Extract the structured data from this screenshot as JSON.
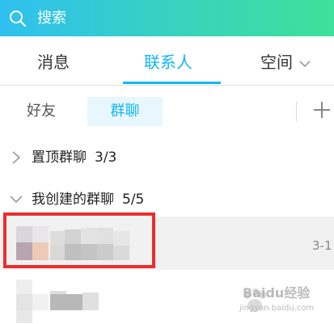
{
  "search": {
    "placeholder": "搜索"
  },
  "tabs": [
    {
      "label": "消息"
    },
    {
      "label": "联系人"
    },
    {
      "label": "空间"
    }
  ],
  "subtabs": {
    "friends": "好友",
    "groups": "群聊"
  },
  "groups": [
    {
      "label": "置顶群聊",
      "count": "3/3",
      "expanded": false
    },
    {
      "label": "我创建的群聊",
      "count": "5/5",
      "expanded": true
    }
  ],
  "rows": [
    {
      "time": "3-1"
    },
    {
      "time": ""
    }
  ],
  "watermark": {
    "text": "Baidu经验",
    "sub": "jingyan.baidu.com"
  },
  "colors": {
    "accent": "#12b7f5",
    "highlight": "#ec2d2d"
  }
}
